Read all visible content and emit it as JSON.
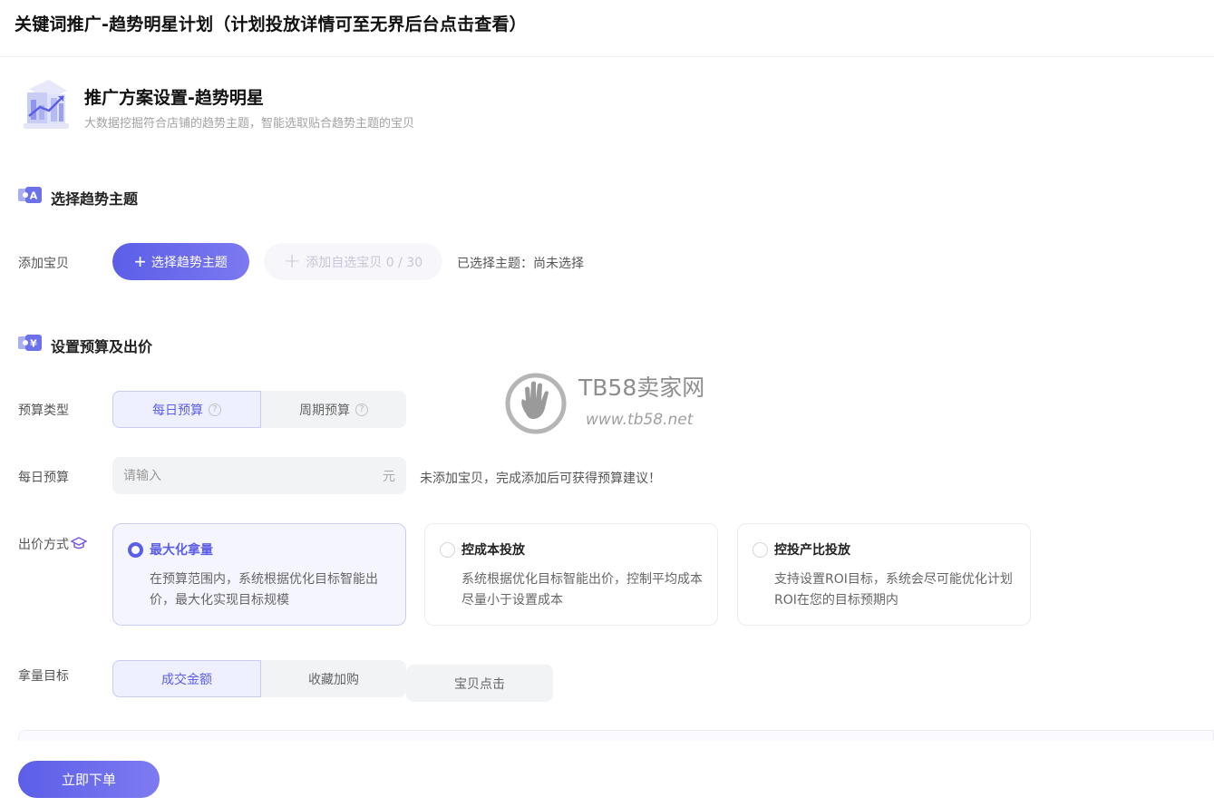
{
  "page": {
    "title": "关键词推广-趋势明星计划（计划投放详情可至无界后台点击查看）"
  },
  "plan": {
    "heading": "推广方案设置-趋势明星",
    "description": "大数据挖掘符合店铺的趋势主题，智能选取贴合趋势主题的宝贝"
  },
  "section_theme": {
    "title": "选择趋势主题",
    "add_label": "添加宝贝",
    "select_button": "选择趋势主题",
    "add_custom_button": "添加自选宝贝 0 / 30",
    "selected_text": "已选择主题：尚未选择"
  },
  "section_budget": {
    "title": "设置预算及出价",
    "budget_type_label": "预算类型",
    "budget_types": [
      "每日预算",
      "周期预算"
    ],
    "selected_budget_type": "每日预算",
    "daily_budget_label": "每日预算",
    "daily_budget_value": "",
    "daily_budget_placeholder": "请输入",
    "daily_budget_unit": "元",
    "budget_hint": "未添加宝贝，完成添加后可获得预算建议！",
    "bid_label": "出价方式",
    "bid_options": [
      {
        "title": "最大化拿量",
        "desc": "在预算范围内，系统根据优化目标智能出价，最大化实现目标规模",
        "selected": true
      },
      {
        "title": "控成本投放",
        "desc": "系统根据优化目标智能出价，控制平均成本尽量小于设置成本",
        "selected": false
      },
      {
        "title": "控投产比投放",
        "desc": "支持设置ROI目标，系统会尽可能优化计划ROI在您的目标预期内",
        "selected": false
      }
    ],
    "goal_label": "拿量目标",
    "goals": [
      "成交金额",
      "收藏加购",
      "宝贝点击"
    ],
    "selected_goal": "成交金额"
  },
  "footer": {
    "order_button": "立即下单"
  },
  "watermark": {
    "name": "TB58卖家网",
    "url": "www.tb58.net"
  },
  "colors": {
    "accent": "#5b5ee8",
    "accent_light": "#eef0ff",
    "muted_bg": "#f2f3f5"
  },
  "icons": {
    "plan": "plan-illustration-icon",
    "theme_section": "ticket-icon",
    "budget_section": "yen-ticket-icon",
    "help": "question-circle-icon",
    "bid_help": "graduation-cap-icon"
  }
}
